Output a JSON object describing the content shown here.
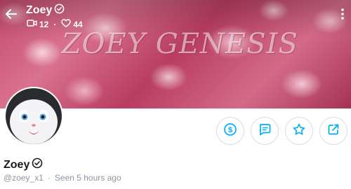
{
  "header": {
    "name": "Zoey",
    "media_count": "12",
    "likes_count": "44"
  },
  "cover": {
    "title_text": "ZOEY GENESIS"
  },
  "profile": {
    "name": "Zoey",
    "username": "@zoey_x1",
    "last_seen": "Seen 5 hours ago"
  },
  "colors": {
    "accent": "#00aff0",
    "muted_text": "#8a96a3",
    "cover_pink": "#c24a6d"
  },
  "icons": {
    "back": "arrow-left-icon",
    "verified": "verified-badge-icon",
    "media": "video-icon",
    "likes": "heart-icon",
    "more": "more-vertical-icon",
    "tip": "dollar-icon",
    "message": "message-icon",
    "favorite": "star-icon",
    "share": "share-icon"
  }
}
